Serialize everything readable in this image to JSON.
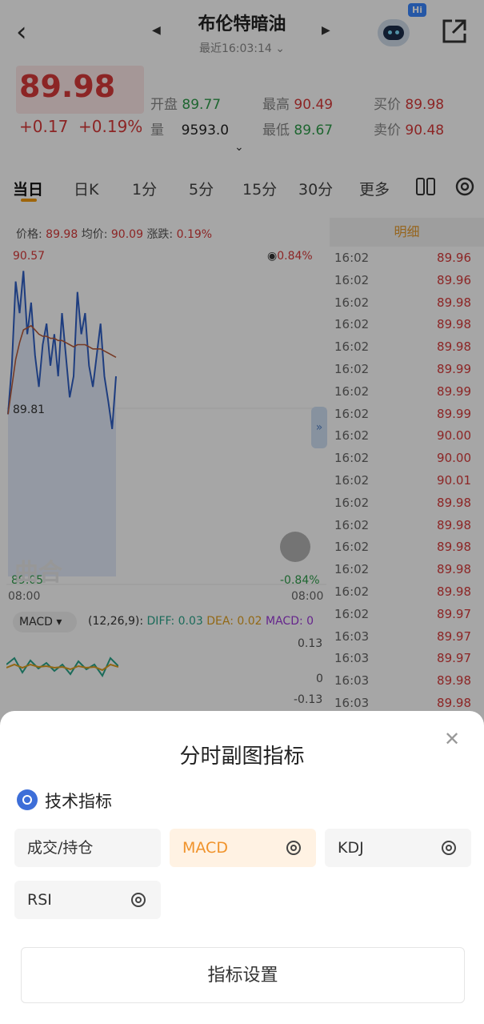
{
  "header": {
    "title": "布伦特暗油",
    "subtitle": "最近16:03:14",
    "hi_badge": "Hi"
  },
  "quote": {
    "price": "89.98",
    "change": "+0.17",
    "change_pct": "+0.19%",
    "open_label": "开盘",
    "open": "89.77",
    "high_label": "最高",
    "high": "90.49",
    "bid_label": "买价",
    "bid": "89.98",
    "volume_label": "量",
    "volume": "9593.0",
    "low_label": "最低",
    "low": "89.67",
    "ask_label": "卖价",
    "ask": "90.48"
  },
  "tabs": [
    "当日",
    "日K",
    "1分",
    "5分",
    "15分",
    "30分",
    "更多"
  ],
  "chart_info": {
    "price_label": "价格:",
    "price": "89.98",
    "avg_label": "均价:",
    "avg": "90.09",
    "change_label": "涨跌:",
    "change": "0.19%"
  },
  "chart": {
    "y_top": "90.57",
    "y_mid": "89.81",
    "y_bottom": "89.05",
    "pct_top": "0.84%",
    "pct_bottom": "-0.84%",
    "x_left": "08:00",
    "x_right": "08:00",
    "watermark": "曲合"
  },
  "chart_data": {
    "type": "line",
    "series": [
      {
        "values": [
          89.82,
          90.05,
          90.45,
          90.3,
          90.5,
          90.2,
          90.35,
          90.1,
          89.95,
          90.15,
          90.25,
          90.05,
          90.2,
          90.0,
          90.3,
          90.1,
          89.9,
          90.0,
          90.4,
          90.2,
          90.3,
          90.05,
          89.95,
          90.1,
          90.25,
          90.0,
          89.88,
          89.75,
          90.0
        ]
      },
      {
        "values": [
          89.82,
          89.95,
          90.08,
          90.16,
          90.22,
          90.23,
          90.24,
          90.22,
          90.2,
          90.19,
          90.19,
          90.18,
          90.18,
          90.17,
          90.17,
          90.16,
          90.15,
          90.14,
          90.15,
          90.15,
          90.15,
          90.14,
          90.13,
          90.13,
          90.13,
          90.12,
          90.11,
          90.1,
          90.09
        ]
      }
    ],
    "ylim": [
      89.05,
      90.57
    ],
    "x": [
      "08:00",
      "08:00"
    ]
  },
  "detail": {
    "header": "明细",
    "rows": [
      {
        "t": "16:02",
        "p": "89.96"
      },
      {
        "t": "16:02",
        "p": "89.96"
      },
      {
        "t": "16:02",
        "p": "89.98"
      },
      {
        "t": "16:02",
        "p": "89.98"
      },
      {
        "t": "16:02",
        "p": "89.98"
      },
      {
        "t": "16:02",
        "p": "89.99"
      },
      {
        "t": "16:02",
        "p": "89.99"
      },
      {
        "t": "16:02",
        "p": "89.99"
      },
      {
        "t": "16:02",
        "p": "90.00"
      },
      {
        "t": "16:02",
        "p": "90.00"
      },
      {
        "t": "16:02",
        "p": "90.01"
      },
      {
        "t": "16:02",
        "p": "89.98"
      },
      {
        "t": "16:02",
        "p": "89.98"
      },
      {
        "t": "16:02",
        "p": "89.98"
      },
      {
        "t": "16:02",
        "p": "89.98"
      },
      {
        "t": "16:02",
        "p": "89.98"
      },
      {
        "t": "16:02",
        "p": "89.97"
      },
      {
        "t": "16:03",
        "p": "89.97"
      },
      {
        "t": "16:03",
        "p": "89.97"
      },
      {
        "t": "16:03",
        "p": "89.98"
      },
      {
        "t": "16:03",
        "p": "89.98"
      }
    ]
  },
  "macd": {
    "label": "MACD",
    "params": "(12,26,9):",
    "diff": "DIFF: 0.03",
    "dea": "DEA: 0.02",
    "macd": "MACD: 0",
    "y_top": "0.13",
    "y_mid": "0",
    "y_bottom": "-0.13"
  },
  "sheet": {
    "title": "分时副图指标",
    "section": "技术指标",
    "options": [
      "成交/持仓",
      "MACD",
      "KDJ",
      "RSI"
    ],
    "settings_button": "指标设置"
  },
  "colors": {
    "up": "#d83a3a",
    "down": "#2e9d4b",
    "accent": "#f0932b",
    "price_line": "#2f5fc4",
    "avg_line": "#b55a3a"
  }
}
